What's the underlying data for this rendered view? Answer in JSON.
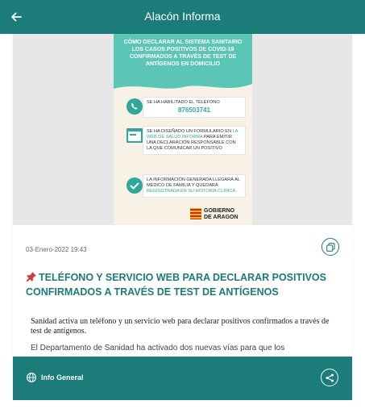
{
  "appbar": {
    "title": "Alacón Informa",
    "back_icon": "arrow-left-icon"
  },
  "poster": {
    "header": "CÓMO DECLARAR AL SISTEMA SANITARIO LOS CASOS POSITIVOS DE COVID-19 CONFIRMADOS A TRAVÉS DE TEST DE ANTÍGENOS EN DOMICILIO",
    "items": [
      {
        "icon": "phone-icon",
        "text": "SE HA HABILITADO EL TELÉFONO",
        "phone": "876503741"
      },
      {
        "icon": "web-form-icon",
        "text_before": "SE HA DISEÑADO UN FORMULARIO EN ",
        "link": "LA WEB DE SALUD INFORMA",
        "text_after": " PARA EMITIR UNA DECLARACIÓN RESPONSABLE CON LA QUE COMUNICAR UN POSITIVO"
      },
      {
        "icon": "check-circle-icon",
        "text_before": "LA INFORMACIÓN GENERADA LLEGARÁ AL MÉDICO DE FAMILIA Y QUEDARÁ ",
        "link": "REGISGTRADA EN SU HISTORIA CLÍNICA",
        "text_after": ""
      }
    ],
    "logo": {
      "line1": "GOBIERNO",
      "line2": "DE ARAGON"
    },
    "colors": {
      "teal": "#5cc6b6",
      "cream": "#f7f1e6"
    }
  },
  "article": {
    "date": "03-Enero-2022 19:43",
    "copy_icon": "copy-icon",
    "pin_icon": "pushpin-icon",
    "title": "TELÉFONO Y SERVICIO WEB PARA DECLARAR POSITIVOS CONFIRMADOS A TRAVÉS DE TEST DE ANTÍGENOS",
    "lead": "Sanidad activa un teléfono y un servicio web para declarar positivos confirmados a través de test de antígenos.",
    "body": "El Departamento de Sanidad ha activado dos nuevas vías para que los"
  },
  "bottombar": {
    "globe_icon": "globe-icon",
    "label": "Info General",
    "share_icon": "share-icon"
  },
  "colors": {
    "primary": "#1b7c7a",
    "background": "#ffffff"
  }
}
